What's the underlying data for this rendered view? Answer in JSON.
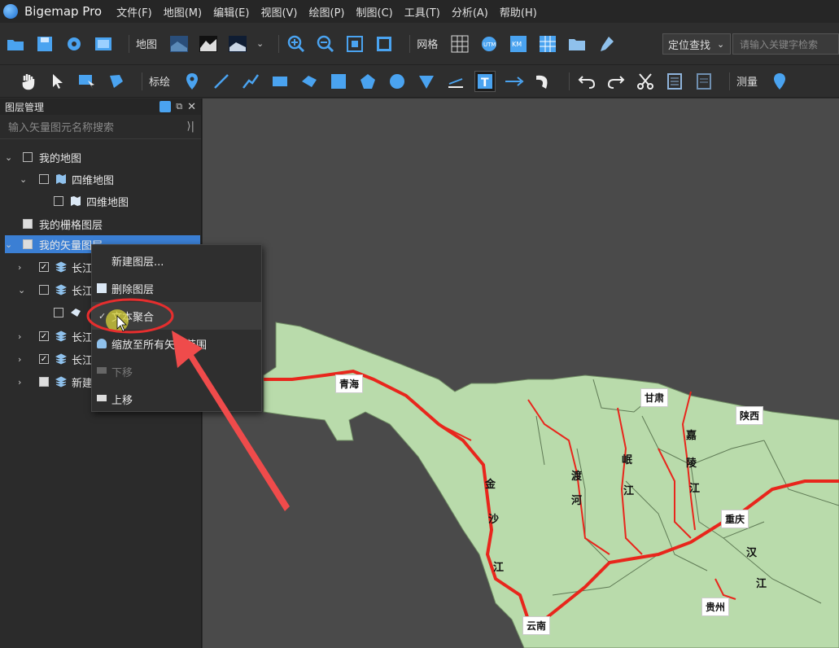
{
  "app": {
    "title": "Bigemap Pro"
  },
  "menu": [
    "文件(F)",
    "地图(M)",
    "编辑(E)",
    "视图(V)",
    "绘图(P)",
    "制图(C)",
    "工具(T)",
    "分析(A)",
    "帮助(H)"
  ],
  "toolbar1": {
    "map_label": "地图",
    "grid_label": "网格",
    "locate_select": "定位查找",
    "search_placeholder": "请输入关键字检索"
  },
  "toolbar2": {
    "annotate_label": "标绘",
    "measure_label": "测量"
  },
  "panel": {
    "title": "图层管理",
    "search_placeholder": "输入矢量图元名称搜索",
    "tree": [
      {
        "label": "我的地图"
      },
      {
        "label": "四维地图"
      },
      {
        "label": "四维地图"
      },
      {
        "label": "我的栅格图层"
      },
      {
        "label": "我的矢量图层"
      },
      {
        "label": "长江"
      },
      {
        "label": "长江"
      },
      {
        "label": ""
      },
      {
        "label": "长江"
      },
      {
        "label": "长江"
      },
      {
        "label": "新建"
      }
    ]
  },
  "context_menu": {
    "items": [
      {
        "label": "新建图层..."
      },
      {
        "label": "删除图层"
      },
      {
        "label": "文本聚合"
      },
      {
        "label": "缩放至所有矢量范围"
      },
      {
        "label": "下移"
      },
      {
        "label": "上移"
      }
    ]
  },
  "map": {
    "labels": [
      "青海",
      "甘肃",
      "陕西",
      "重庆",
      "贵州",
      "云南"
    ],
    "river_labels": [
      "金",
      "沙",
      "江",
      "渡",
      "河",
      "岷",
      "江",
      "嘉",
      "陵",
      "江",
      "汉",
      "江"
    ]
  },
  "colors": {
    "land": "#b9dbab",
    "river": "#e8261c",
    "accent": "#4a8fe0",
    "highlight_ring": "#e62e2e"
  }
}
